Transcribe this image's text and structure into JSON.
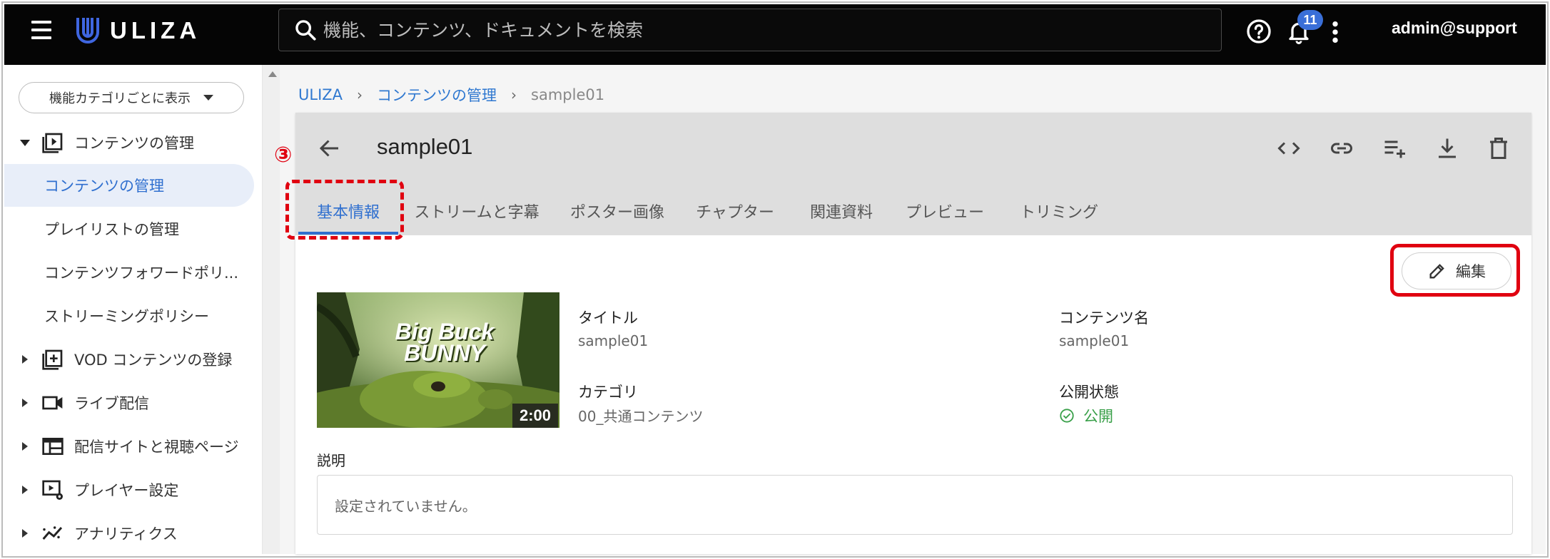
{
  "header": {
    "logo_text": "ULIZA",
    "search_placeholder": "機能、コンテンツ、ドキュメントを検索",
    "notification_count": "11",
    "user": "admin@support"
  },
  "sidebar": {
    "category_select": "機能カテゴリごとに表示",
    "items": [
      {
        "label": "コンテンツの管理",
        "icon": "play-box-icon",
        "expanded": true
      },
      {
        "label": "VOD コンテンツの登録",
        "icon": "add-box-icon"
      },
      {
        "label": "ライブ配信",
        "icon": "video-camera-icon"
      },
      {
        "label": "配信サイトと視聴ページ",
        "icon": "web-page-icon"
      },
      {
        "label": "プレイヤー設定",
        "icon": "player-settings-icon"
      },
      {
        "label": "アナリティクス",
        "icon": "analytics-icon"
      }
    ],
    "sub_items": [
      {
        "label": "コンテンツの管理",
        "active": true
      },
      {
        "label": "プレイリストの管理"
      },
      {
        "label": "コンテンツフォワードポリ..."
      },
      {
        "label": "ストリーミングポリシー"
      }
    ]
  },
  "breadcrumb": {
    "root": "ULIZA",
    "section": "コンテンツの管理",
    "current": "sample01"
  },
  "content": {
    "title": "sample01",
    "tabs": [
      "基本情報",
      "ストリームと字幕",
      "ポスター画像",
      "チャプター",
      "関連資料",
      "プレビュー",
      "トリミング"
    ],
    "active_tab": "基本情報",
    "edit_label": "編集",
    "thumbnail": {
      "logo_line1": "Big Buck",
      "logo_line2": "BUNNY",
      "duration": "2:00"
    },
    "fields": {
      "title_label": "タイトル",
      "title_value": "sample01",
      "name_label": "コンテンツ名",
      "name_value": "sample01",
      "category_label": "カテゴリ",
      "category_value": "00_共通コンテンツ",
      "status_label": "公開状態",
      "status_value": "公開"
    },
    "description_label": "説明",
    "description_value": "設定されていません。"
  },
  "annotation": {
    "step": "③",
    "color": "#e00010"
  }
}
